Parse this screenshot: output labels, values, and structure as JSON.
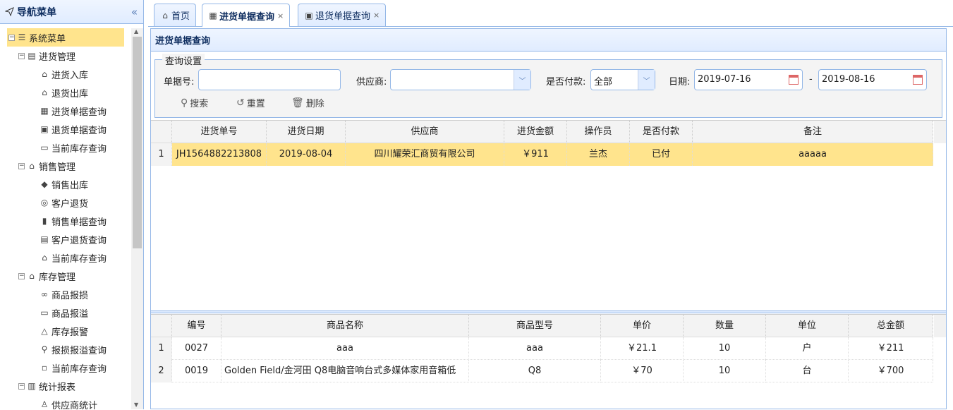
{
  "sidebar": {
    "title": "导航菜单",
    "collapse_glyph": "«",
    "root": "系统菜单",
    "groups": [
      {
        "label": "进货管理",
        "items": [
          "进货入库",
          "退货出库",
          "进货单据查询",
          "退货单据查询",
          "当前库存查询"
        ]
      },
      {
        "label": "销售管理",
        "items": [
          "销售出库",
          "客户退货",
          "销售单据查询",
          "客户退货查询",
          "当前库存查询"
        ]
      },
      {
        "label": "库存管理",
        "items": [
          "商品报损",
          "商品报溢",
          "库存报警",
          "报损报溢查询",
          "当前库存查询"
        ]
      },
      {
        "label": "统计报表",
        "items": [
          "供应商统计"
        ]
      }
    ]
  },
  "tabs": [
    {
      "label": "首页",
      "closable": false
    },
    {
      "label": "进货单据查询",
      "closable": true
    },
    {
      "label": "退货单据查询",
      "closable": true
    }
  ],
  "tab_close": "×",
  "panel": {
    "title": "进货单据查询"
  },
  "query": {
    "legend": "查询设置",
    "bill_no_label": "单据号:",
    "bill_no_value": "",
    "supplier_label": "供应商:",
    "supplier_value": "",
    "paid_label": "是否付款:",
    "paid_value": "全部",
    "date_label": "日期:",
    "date_from": "2019-07-16",
    "date_sep": "-",
    "date_to": "2019-08-16",
    "search_label": "搜索",
    "reset_label": "重置",
    "delete_label": "删除"
  },
  "main_grid": {
    "columns": [
      "进货单号",
      "进货日期",
      "供应商",
      "进货金额",
      "操作员",
      "是否付款",
      "备注"
    ],
    "rows": [
      {
        "num": "1",
        "cells": [
          "JH1564882213808",
          "2019-08-04",
          "四川耀荣汇商贸有限公司",
          "￥911",
          "兰杰",
          "已付",
          "aaaaa"
        ]
      }
    ]
  },
  "detail_grid": {
    "columns": [
      "编号",
      "商品名称",
      "商品型号",
      "单价",
      "数量",
      "单位",
      "总金额"
    ],
    "rows": [
      {
        "num": "1",
        "cells": [
          "0027",
          "aaa",
          "aaa",
          "￥21.1",
          "10",
          "户",
          "￥211"
        ]
      },
      {
        "num": "2",
        "cells": [
          "0019",
          "Golden Field/金河田 Q8电脑音响台式多媒体家用音箱低",
          "Q8",
          "￥70",
          "10",
          "台",
          "￥700"
        ]
      }
    ]
  }
}
